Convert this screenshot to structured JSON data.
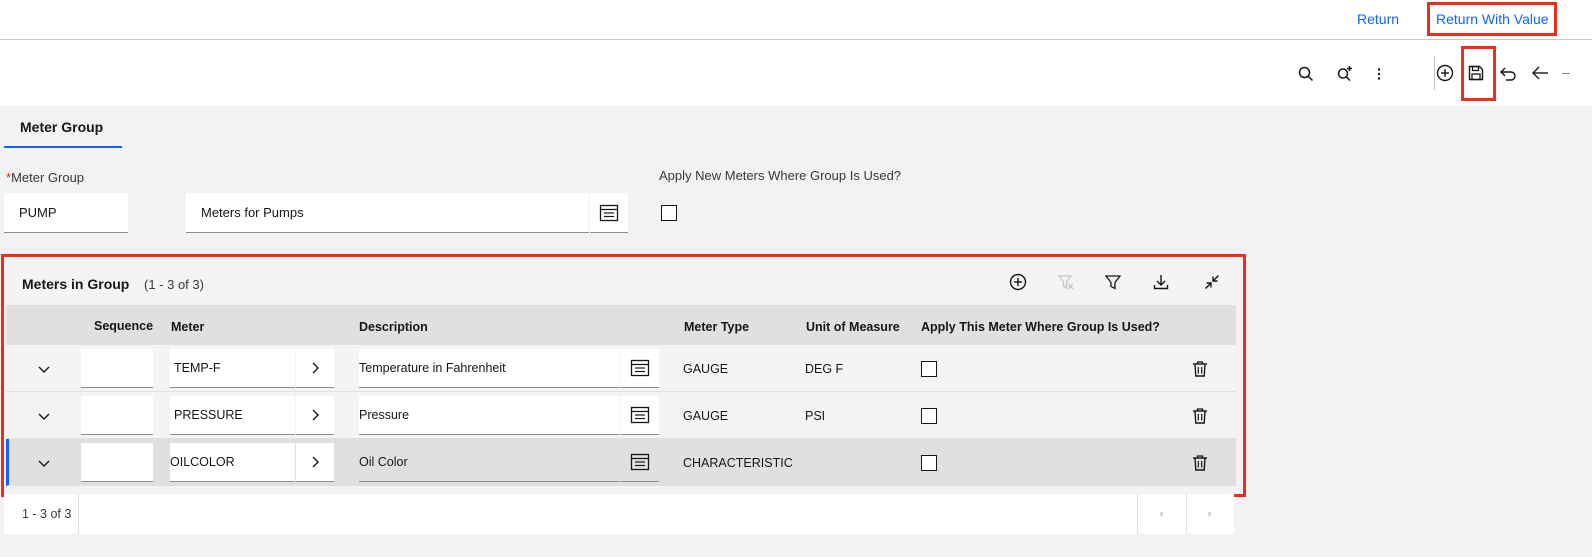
{
  "topbar": {
    "return_label": "Return",
    "return_with_value_label": "Return With Value"
  },
  "toolbar": {
    "icons": [
      "search-icon",
      "search-plus-icon",
      "overflow-menu-icon",
      "add-icon",
      "save-icon",
      "undo-icon",
      "back-arrow-icon"
    ]
  },
  "tab": {
    "label": "Meter Group"
  },
  "form": {
    "meter_group_label": "Meter Group",
    "required_mark": "*",
    "meter_group_value": "PUMP",
    "description_value": "Meters for Pumps",
    "apply_label": "Apply New Meters Where Group Is Used?"
  },
  "table": {
    "title": "Meters in Group",
    "count": "(1 - 3 of 3)",
    "headers": {
      "sequence": "Sequence",
      "meter": "Meter",
      "description": "Description",
      "meter_type": "Meter Type",
      "unit": "Unit of Measure",
      "apply": "Apply This Meter Where Group Is Used?"
    },
    "rows": [
      {
        "sequence": "",
        "meter": "TEMP-F",
        "description": "Temperature in Fahrenheit",
        "meter_type": "GAUGE",
        "unit": "DEG F"
      },
      {
        "sequence": "",
        "meter": "PRESSURE",
        "description": "Pressure",
        "meter_type": "GAUGE",
        "unit": "PSI"
      },
      {
        "sequence": "",
        "meter": "OILCOLOR",
        "description": "Oil Color",
        "meter_type": "CHARACTERISTIC",
        "unit": ""
      }
    ],
    "footer_count": "1 - 3 of 3"
  },
  "colors": {
    "link": "#0f62fe",
    "highlight": "#ee2c1b",
    "selected_row": "#e0e0e0"
  }
}
